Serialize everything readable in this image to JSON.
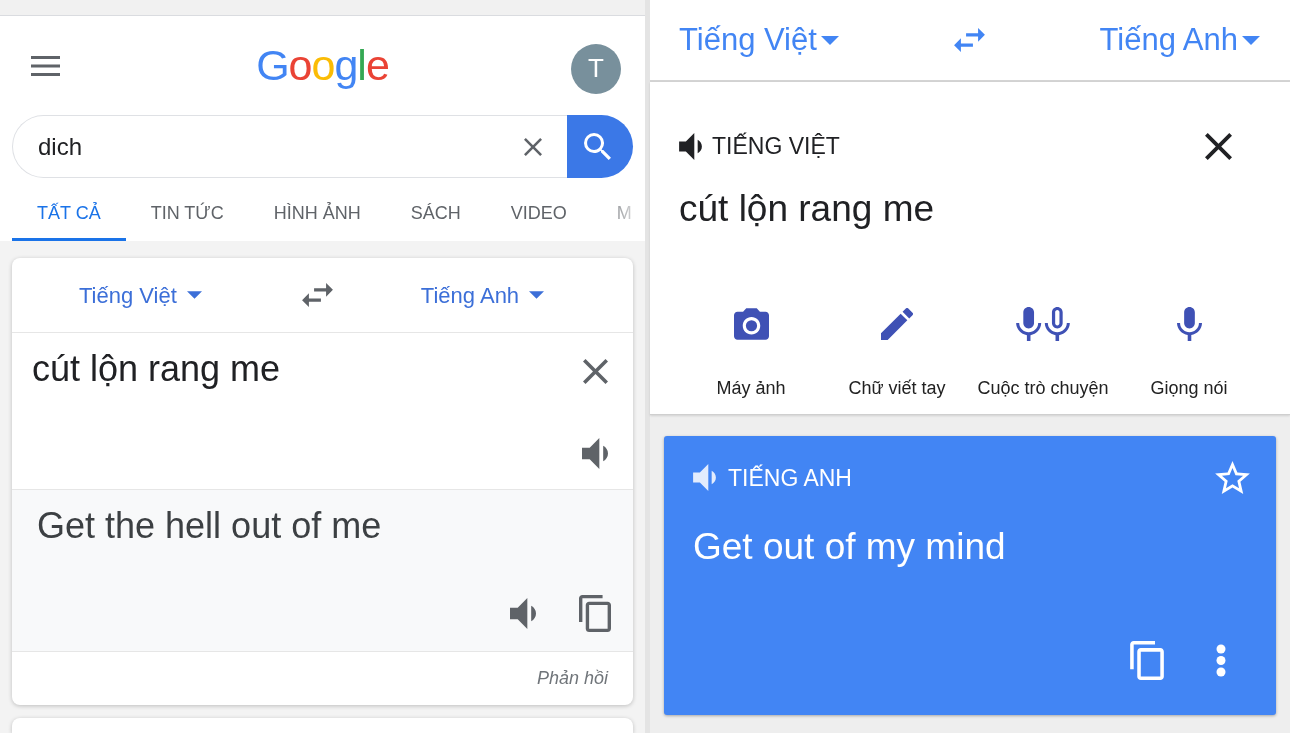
{
  "search_page": {
    "logo": "Google",
    "avatar": {
      "initial": "T"
    },
    "search": {
      "value": "dich"
    },
    "tabs": [
      {
        "label": "TẤT CẢ",
        "selected": true
      },
      {
        "label": "TIN TỨC",
        "selected": false
      },
      {
        "label": "HÌNH ẢNH",
        "selected": false
      },
      {
        "label": "SÁCH",
        "selected": false
      },
      {
        "label": "VIDEO",
        "selected": false
      },
      {
        "label": "M",
        "selected": false
      }
    ],
    "translate_card": {
      "source_language": "Tiếng Việt",
      "target_language": "Tiếng Anh",
      "source_text": "cút lộn rang me",
      "translation": "Get the hell out of me",
      "feedback": "Phản hồi"
    }
  },
  "translate_app": {
    "source_language": "Tiếng Việt",
    "target_language": "Tiếng Anh",
    "input": {
      "language_label": "TIẾNG VIỆT",
      "text": "cút lộn rang me"
    },
    "input_tools": [
      {
        "kind": "camera",
        "label": "Máy ảnh"
      },
      {
        "kind": "handwriting",
        "label": "Chữ viết tay"
      },
      {
        "kind": "conversation",
        "label": "Cuộc trò chuyện"
      },
      {
        "kind": "voice",
        "label": "Giọng nói"
      }
    ],
    "result": {
      "language_label": "TIẾNG ANH",
      "text": "Get out of my mind"
    }
  }
}
